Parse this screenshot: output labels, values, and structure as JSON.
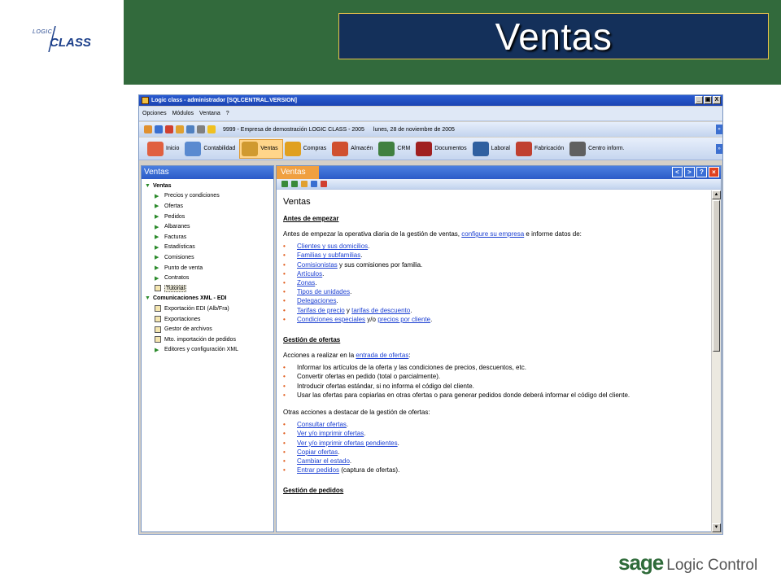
{
  "slide": {
    "title": "Ventas",
    "logo_top": "LOGIC",
    "logo_bottom": "CLASS",
    "footer_brand": "sage",
    "footer_product": "Logic Control",
    "colors": {
      "green_band": "#326a3c",
      "title_bg": "#14305a",
      "title_border": "#e7c24a"
    }
  },
  "window": {
    "title": "Logic class - administrador [SQLCENTRAL.VERSION]",
    "controls": [
      "_",
      "▣",
      "X"
    ]
  },
  "menu": [
    "Opciones",
    "Módulos",
    "Ventana",
    "?"
  ],
  "info_bar": {
    "company": "9999 - Empresa de demostración LOGIC CLASS - 2005",
    "date": "lunes, 28 de noviembre de 2005"
  },
  "modules": [
    {
      "label": "Inicio",
      "icon": "home-icon",
      "color": "#e06040"
    },
    {
      "label": "Contabilidad",
      "icon": "accounting-icon",
      "color": "#5a8ad0"
    },
    {
      "label": "Ventas",
      "icon": "sales-icon",
      "color": "#d09a30",
      "active": true
    },
    {
      "label": "Compras",
      "icon": "purchases-icon",
      "color": "#e0a020"
    },
    {
      "label": "Almacén",
      "icon": "warehouse-icon",
      "color": "#d05030"
    },
    {
      "label": "CRM",
      "icon": "crm-icon",
      "color": "#408040"
    },
    {
      "label": "Documentos",
      "icon": "documents-icon",
      "color": "#a02020"
    },
    {
      "label": "Laboral",
      "icon": "labor-icon",
      "color": "#3060a0"
    },
    {
      "label": "Fabricación",
      "icon": "manufacturing-icon",
      "color": "#c04030"
    },
    {
      "label": "Centro inform.",
      "icon": "info-center-icon",
      "color": "#606060"
    }
  ],
  "left_panel": {
    "title": "Ventas",
    "items": [
      {
        "label": "Ventas",
        "type": "group"
      },
      {
        "label": "Precios y condiciones",
        "type": "item"
      },
      {
        "label": "Ofertas",
        "type": "item"
      },
      {
        "label": "Pedidos",
        "type": "item"
      },
      {
        "label": "Albaranes",
        "type": "item"
      },
      {
        "label": "Facturas",
        "type": "item"
      },
      {
        "label": "Estadísticas",
        "type": "item"
      },
      {
        "label": "Comisiones",
        "type": "item"
      },
      {
        "label": "Punto de venta",
        "type": "item"
      },
      {
        "label": "Contratos",
        "type": "item"
      },
      {
        "label": "Tutorial",
        "type": "icon-item",
        "selected": true
      },
      {
        "label": "Comunicaciones XML - EDI",
        "type": "group"
      },
      {
        "label": "Exportación EDI (Alb/Fra)",
        "type": "icon-item"
      },
      {
        "label": "Exportaciones",
        "type": "icon-item"
      },
      {
        "label": "Gestor de archivos",
        "type": "icon-item"
      },
      {
        "label": "Mto. importación de pedidos",
        "type": "icon-item"
      },
      {
        "label": "Editores y configuración XML",
        "type": "item"
      }
    ]
  },
  "right_panel": {
    "tab": "Ventas"
  },
  "doc": {
    "title": "Ventas",
    "sec1": {
      "title": "Antes de empezar",
      "intro_pre": "Antes de empezar la operativa diaria de la gestión de ventas, ",
      "intro_link": "configure su empresa",
      "intro_post": " e informe datos de:",
      "items": [
        {
          "link": "Clientes y sus domicilios",
          "post": "."
        },
        {
          "link": "Familias y subfamilias",
          "post": "."
        },
        {
          "link": "Comisionistas",
          "post": " y sus comisiones por familia."
        },
        {
          "link": "Artículos",
          "post": "."
        },
        {
          "link": "Zonas",
          "post": "."
        },
        {
          "link": "Tipos de unidades",
          "post": "."
        },
        {
          "link": "Delegaciones",
          "post": "."
        },
        {
          "link": "Tarifas de precio",
          "mid": " y ",
          "link2": "tarifas de descuento",
          "post": "."
        },
        {
          "link": "Condiciones especiales",
          "mid": " y/o ",
          "link2": "precios por cliente",
          "post": "."
        }
      ]
    },
    "sec2": {
      "title": "Gestión de ofertas",
      "intro_pre": "Acciones a realizar en la ",
      "intro_link": "entrada de ofertas",
      "intro_post": ":",
      "actions": [
        "Informar los artículos de la oferta y las condiciones de precios, descuentos, etc.",
        "Convertir ofertas en pedido (total o parcialmente).",
        "Introducir ofertas estándar, si no informa el código del cliente.",
        "Usar las ofertas para copiarlas en otras ofertas o para generar pedidos donde deberá informar el código del cliente."
      ],
      "other_intro": "Otras acciones a destacar de la gestión de ofertas:",
      "other": [
        {
          "link": "Consultar ofertas",
          "post": "."
        },
        {
          "link": "Ver y/o imprimir ofertas",
          "post": "."
        },
        {
          "link": "Ver y/o imprimir ofertas pendientes",
          "post": "."
        },
        {
          "link": "Copiar ofertas",
          "post": "."
        },
        {
          "link": "Cambiar el estado",
          "post": "."
        },
        {
          "link": "Entrar pedidos",
          "post": " (captura de ofertas)."
        }
      ]
    },
    "sec3": {
      "title": "Gestión de pedidos"
    }
  }
}
